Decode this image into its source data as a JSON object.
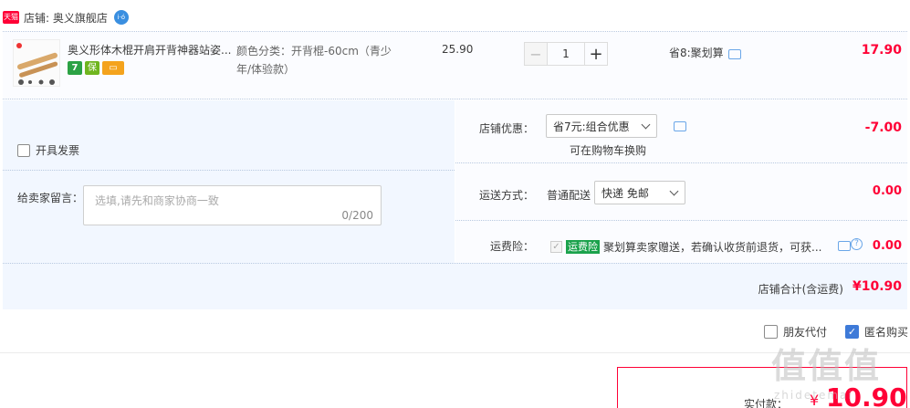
{
  "shop": {
    "badge": "天猫",
    "name": "店铺: 奥义旗舰店",
    "chat_badge": "i·ó"
  },
  "item": {
    "title": "奥义形体木棍开肩开背神器站姿...",
    "sku": "颜色分类：开背棍-60cm（青少年/体验款）",
    "unit_price": "25.90",
    "quantity": "1",
    "minus": "−",
    "plus": "+",
    "saving": "省8:聚划算",
    "total": "17.90",
    "services": [
      "7",
      "保",
      "▭"
    ]
  },
  "left": {
    "invoice_label": "开具发票",
    "memo_label": "给卖家留言：",
    "memo_placeholder": "选填,请先和商家协商一致",
    "memo_count": "0/200"
  },
  "right": {
    "promo_label": "店铺优惠：",
    "promo_selected": "省7元:组合优惠",
    "promo_hint": "可在购物车换购",
    "promo_amount": "-7.00",
    "ship_label": "运送方式：",
    "ship_method": "普通配送",
    "ship_selected": "快递 免邮",
    "ship_amount": "0.00",
    "ins_label": "运费险：",
    "ins_tag": "运费险",
    "ins_desc": "聚划算卖家赠送，若确认收货前退货，可获...",
    "ins_amount": "0.00"
  },
  "subtotal": {
    "label": "店铺合计(含运费)",
    "value": "¥10.90"
  },
  "options": {
    "friend_pay": "朋友代付",
    "anonymous": "匿名购买"
  },
  "pay": {
    "label": "实付款：",
    "currency": "¥",
    "value": "10.90"
  },
  "watermark": {
    "text": "值值值",
    "sub": "zhidetemai"
  }
}
